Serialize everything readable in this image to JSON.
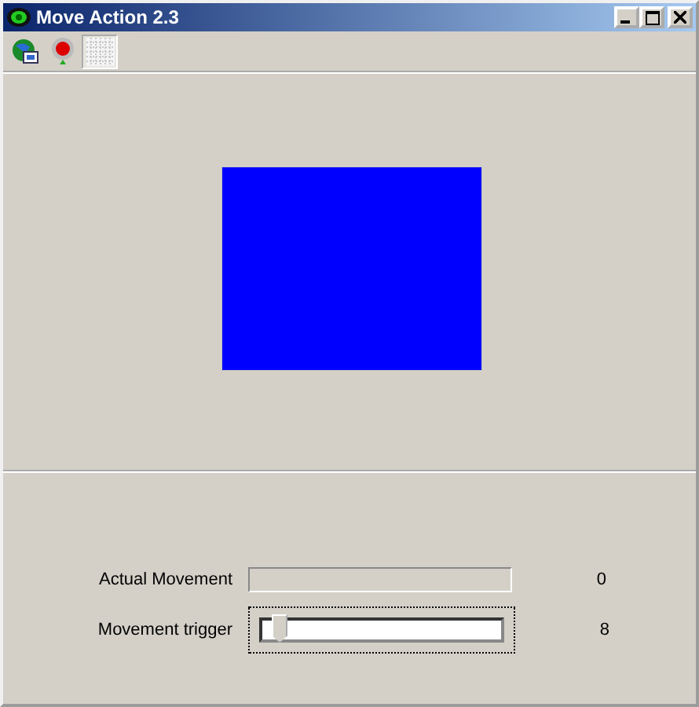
{
  "window": {
    "title": "Move Action 2.3"
  },
  "toolbar": [
    {
      "kind": "globe",
      "pressed": false
    },
    {
      "kind": "record",
      "pressed": false
    },
    {
      "kind": "grid",
      "pressed": true
    }
  ],
  "controls": [
    {
      "kind": "progress",
      "label": "Actual Movement",
      "level": 0,
      "reading": "0"
    },
    {
      "kind": "slider",
      "label": "Movement trigger",
      "level": 0.04,
      "reading": "8"
    }
  ]
}
